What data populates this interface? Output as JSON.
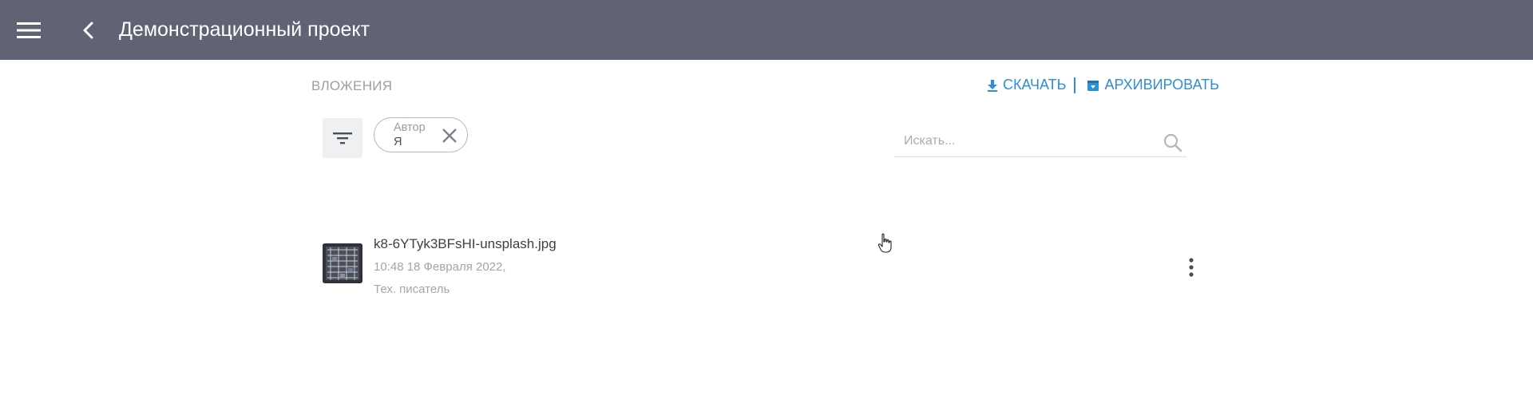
{
  "header": {
    "title": "Демонстрационный проект",
    "background_color": "#5f6373"
  },
  "attachments": {
    "section_title": "ВЛОЖЕНИЯ",
    "download_label": "СКАЧАТЬ",
    "archive_label": "АРХИВИРОВАТЬ",
    "accent_color": "#2d8fd6"
  },
  "filter": {
    "chip_label": "Автор",
    "chip_value": "Я"
  },
  "search": {
    "placeholder": "Искать..."
  },
  "files": [
    {
      "name": "k8-6YTyk3BFsHI-unsplash.jpg",
      "date": "10:48 18 Февраля 2022,",
      "author": "Тех. писатель"
    }
  ],
  "icons": {
    "menu": "hamburger-icon",
    "back": "chevron-left-icon",
    "download": "download-icon",
    "archive": "archive-icon",
    "filter": "filter-icon",
    "close": "close-icon",
    "search": "search-icon",
    "more": "more-vertical-icon"
  }
}
